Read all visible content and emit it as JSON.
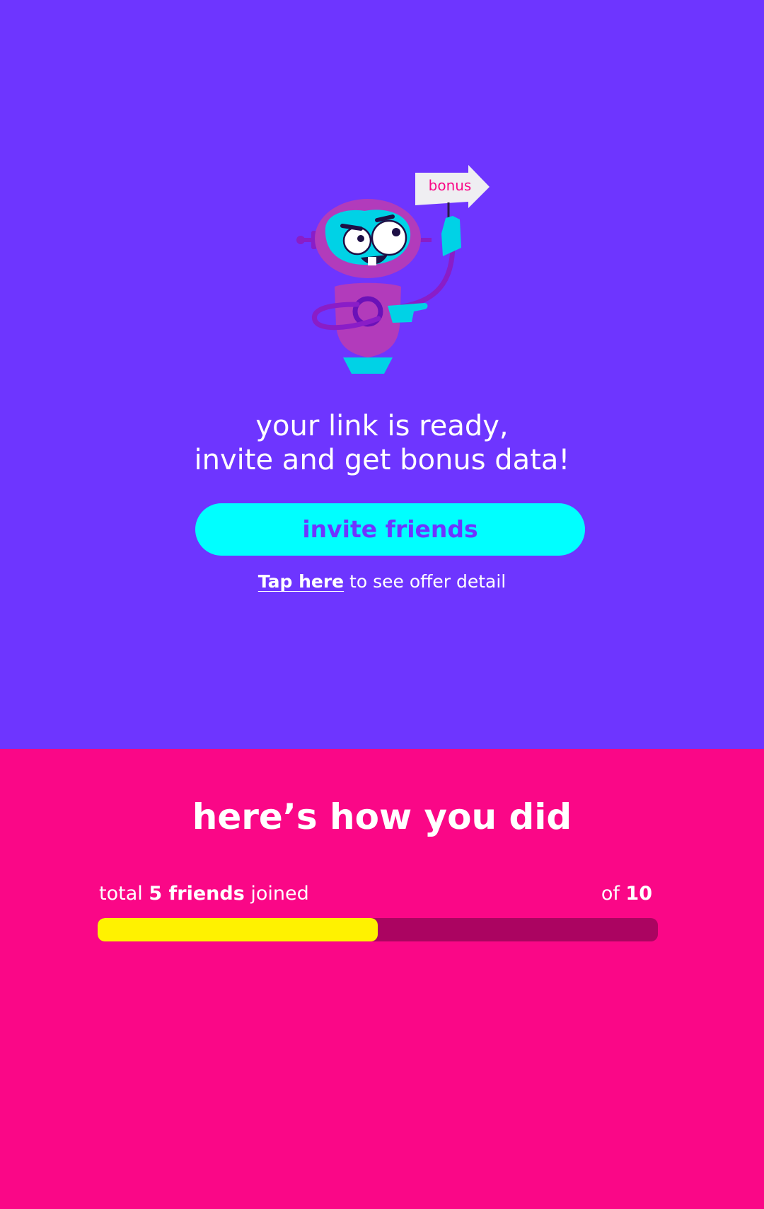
{
  "hero": {
    "sign_label": "bonus",
    "headline_line1": "your link is ready,",
    "headline_line2": "invite and get bonus data!",
    "invite_button_label": "invite friends",
    "offer_link_label": "Tap here",
    "offer_suffix": " to see offer detail"
  },
  "results": {
    "title": "here’s how you did",
    "total_prefix": "total ",
    "friends_joined": "5 friends",
    "joined_suffix": " joined",
    "of_prefix": "of ",
    "goal": "10",
    "progress_fraction": 0.5
  },
  "colors": {
    "top_background": "#6e35ff",
    "bottom_background": "#fa0787",
    "button_background": "#00ffff",
    "progress_fill": "#fff200",
    "progress_track": "#ab0461"
  },
  "icons": {
    "illustration": "robot-with-bonus-sign-icon"
  }
}
